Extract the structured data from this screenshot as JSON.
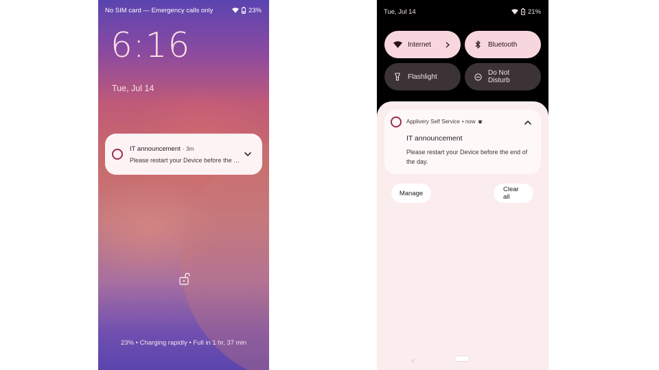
{
  "lock_screen": {
    "status_bar": {
      "carrier": "No SIM card — Emergency calls only",
      "battery": "23%"
    },
    "clock": "6:16",
    "date": "Tue, Jul 14",
    "notification": {
      "title": "IT announcement",
      "time": "· 3m",
      "body": "Please restart your Device before the end of the day."
    },
    "charging_text": "23% • Charging rapidly • Full in 1 hr, 37 min"
  },
  "notification_shade": {
    "status_bar": {
      "date": "Tue, Jul 14",
      "battery": "21%"
    },
    "quick_settings": [
      {
        "label": "Internet",
        "icon": "wifi-icon",
        "active": true
      },
      {
        "label": "Bluetooth",
        "icon": "bluetooth-icon",
        "active": true
      },
      {
        "label": "Flashlight",
        "icon": "flashlight-icon",
        "active": false
      },
      {
        "label": "Do Not Disturb",
        "icon": "do-not-disturb-icon",
        "active": false
      }
    ],
    "notification": {
      "app": "Applivery Self Service",
      "time": "• now",
      "title": "IT announcement",
      "body": "Please restart your Device before the end of the day."
    },
    "actions": {
      "manage": "Manage",
      "clear_all": "Clear all"
    }
  },
  "colors": {
    "accent_ring": "#9b2b51",
    "tile_active": "#f8d6de",
    "tile_inactive": "#3b3335",
    "panel_bg": "#fbeced"
  }
}
